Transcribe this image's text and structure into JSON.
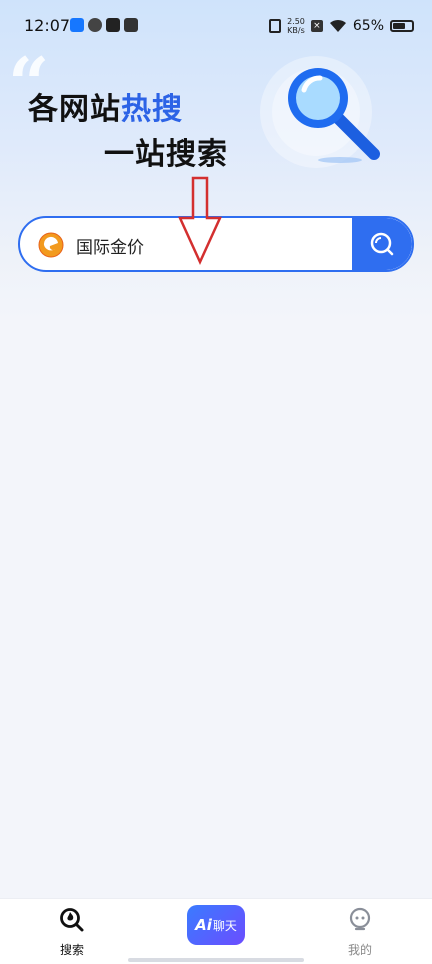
{
  "status_bar": {
    "time": "12:07",
    "net_speed_value": "2.50",
    "net_speed_unit": "KB/s",
    "battery": "65%"
  },
  "hero": {
    "line1_part1": "各网站",
    "line1_highlight": "热搜",
    "line2": "一站搜索",
    "highlight_color": "#2c63e6"
  },
  "search": {
    "value": "国际金价",
    "accent_color": "#2f6ef0"
  },
  "bottom_nav": {
    "search_label": "搜索",
    "ai_label": "Ai",
    "chat_label": "聊天",
    "mine_label": "我的"
  },
  "icons": {
    "search_button": "search-icon",
    "engine": "search-engine-logo",
    "hero": "magnifier-illustration",
    "nav_search": "search-nav-icon",
    "nav_mine": "robot-face-icon"
  },
  "colors": {
    "background": "#f3f5fa",
    "arrow": "#d32f2f"
  }
}
